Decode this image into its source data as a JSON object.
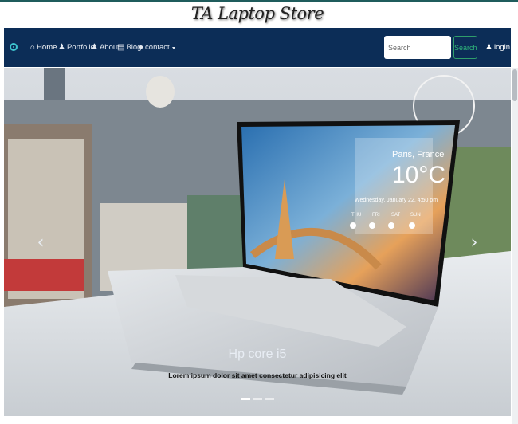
{
  "brand": {
    "title": "TA Laptop Store"
  },
  "nav": {
    "items": [
      {
        "label": "Home",
        "icon": "home-icon",
        "active": true
      },
      {
        "label": "Portfolio",
        "icon": "person-icon"
      },
      {
        "label": "About",
        "icon": "person-icon"
      },
      {
        "label": "Blog",
        "icon": "book-icon"
      },
      {
        "label": "contact",
        "icon": "chat-icon",
        "dropdown": true
      }
    ],
    "search_placeholder": "Search",
    "search_button": "Search",
    "login_label": "login"
  },
  "carousel": {
    "caption_title": "Hp core i5",
    "caption_text": "Lorem ipsum dolor sit amet consectetur adipisicing elit",
    "slide_count": 3,
    "active_slide": 1
  },
  "screen_weather": {
    "city": "Paris, France",
    "temperature": "10°C",
    "date": "Wednesday, January 22, 4:50 pm",
    "days": [
      "THU",
      "FRI",
      "SAT",
      "SUN"
    ]
  },
  "colors": {
    "navbar": "#0c2d57",
    "accent": "#2fb47a",
    "logo": "#3fc6d0"
  }
}
